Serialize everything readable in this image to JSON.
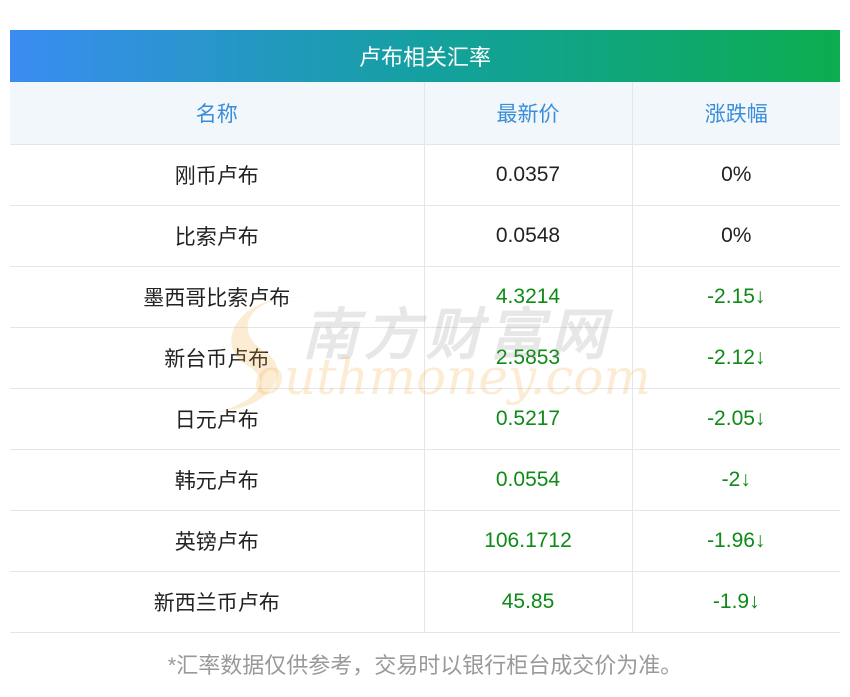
{
  "title": "卢布相关汇率",
  "columns": [
    "名称",
    "最新价",
    "涨跌幅"
  ],
  "rows": [
    {
      "name": "刚币卢布",
      "price": "0.0357",
      "change": "0%",
      "trend": "flat"
    },
    {
      "name": "比索卢布",
      "price": "0.0548",
      "change": "0%",
      "trend": "flat"
    },
    {
      "name": "墨西哥比索卢布",
      "price": "4.3214",
      "change": "-2.15↓",
      "trend": "down"
    },
    {
      "name": "新台币卢布",
      "price": "2.5853",
      "change": "-2.12↓",
      "trend": "down"
    },
    {
      "name": "日元卢布",
      "price": "0.5217",
      "change": "-2.05↓",
      "trend": "down"
    },
    {
      "name": "韩元卢布",
      "price": "0.0554",
      "change": "-2↓",
      "trend": "down"
    },
    {
      "name": "英镑卢布",
      "price": "106.1712",
      "change": "-1.96↓",
      "trend": "down"
    },
    {
      "name": "新西兰币卢布",
      "price": "45.85",
      "change": "-1.9↓",
      "trend": "down"
    }
  ],
  "note": "*汇率数据仅供参考，交易时以银行柜台成交价为准。",
  "watermark": {
    "cn": "南方财富网",
    "en": "outhmoney.com"
  },
  "colors": {
    "header_text": "#3a8ed8",
    "down": "#0e8a16",
    "gradient_start": "#3a8cf2",
    "gradient_end": "#0bad4f"
  }
}
